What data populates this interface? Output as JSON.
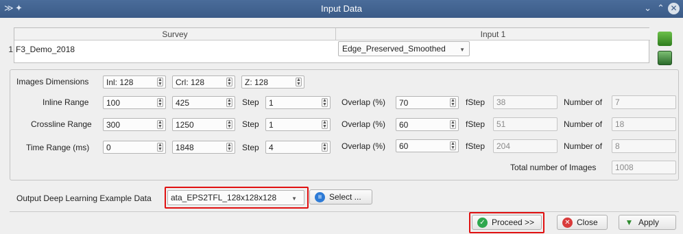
{
  "window": {
    "title": "Input Data"
  },
  "table": {
    "headers": [
      "Survey",
      "Input 1"
    ],
    "row": {
      "number": "1",
      "survey": "F3_Demo_2018",
      "input": "Edge_Preserved_Smoothed"
    }
  },
  "dimensions": {
    "label": "Images Dimensions",
    "inl": "Inl: 128",
    "crl": "Crl: 128",
    "z": "Z: 128"
  },
  "ranges": [
    {
      "label": "Inline Range",
      "start": "100",
      "stop": "425",
      "step_label": "Step",
      "step": "1",
      "overlap_label": "Overlap (%)",
      "overlap": "70",
      "fstep_label": "fStep",
      "fstep": "38",
      "number_label": "Number of",
      "number": "7"
    },
    {
      "label": "Crossline Range",
      "start": "300",
      "stop": "1250",
      "step_label": "Step",
      "step": "1",
      "overlap_label": "Overlap (%)",
      "overlap": "60",
      "fstep_label": "fStep",
      "fstep": "51",
      "number_label": "Number of",
      "number": "18"
    },
    {
      "label": "Time Range (ms)",
      "start": "0",
      "stop": "1848",
      "step_label": "Step",
      "step": "4",
      "overlap_label": "Overlap (%)",
      "overlap": "60",
      "fstep_label": "fStep",
      "fstep": "204",
      "number_label": "Number of",
      "number": "8"
    }
  ],
  "total": {
    "label": "Total number of Images",
    "value": "1008"
  },
  "output": {
    "label": "Output Deep Learning Example Data",
    "value": "ata_EPS2TFL_128x128x128",
    "select_label": "Select ..."
  },
  "buttons": {
    "proceed": "Proceed >>",
    "close": "Close",
    "apply": "Apply"
  },
  "colors": {
    "highlight": "#e01010",
    "titlebar": "#3b5b87",
    "proceed_icon": "#2fa84f",
    "close_icon": "#d93a3a",
    "select_icon": "#2e7bd6",
    "apply_icon": "#2e8b2e"
  }
}
